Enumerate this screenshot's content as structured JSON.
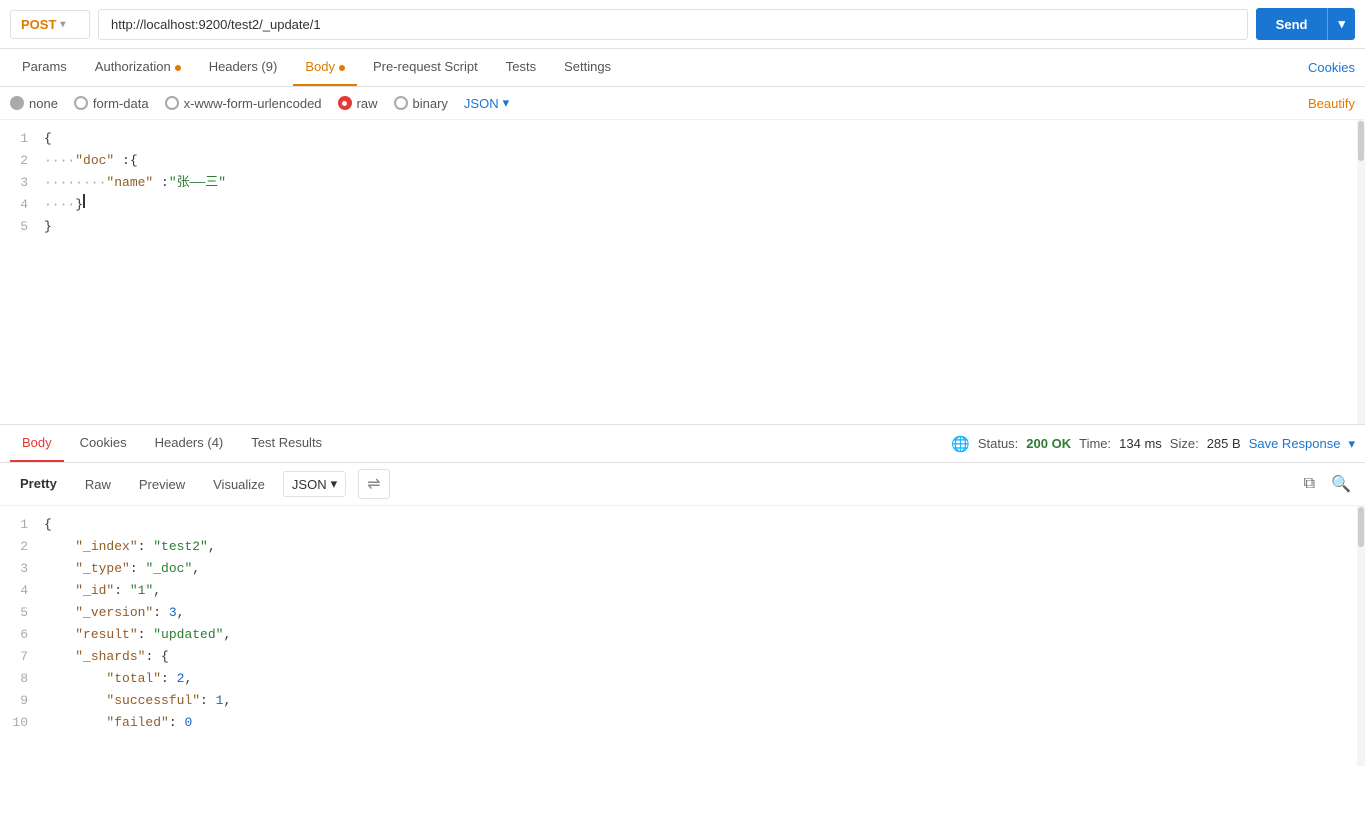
{
  "url_bar": {
    "method": "POST",
    "url": "http://localhost:9200/test2/_update/1",
    "send_label": "Send"
  },
  "request_tabs": {
    "items": [
      {
        "label": "Params",
        "active": false,
        "dot": null
      },
      {
        "label": "Authorization",
        "active": false,
        "dot": "orange"
      },
      {
        "label": "Headers (9)",
        "active": false,
        "dot": null
      },
      {
        "label": "Body",
        "active": true,
        "dot": "orange"
      },
      {
        "label": "Pre-request Script",
        "active": false,
        "dot": null
      },
      {
        "label": "Tests",
        "active": false,
        "dot": null
      },
      {
        "label": "Settings",
        "active": false,
        "dot": null
      }
    ],
    "cookies_link": "Cookies"
  },
  "body_options": {
    "none_label": "none",
    "form_data_label": "form-data",
    "urlencoded_label": "x-www-form-urlencoded",
    "raw_label": "raw",
    "binary_label": "binary",
    "json_label": "JSON",
    "beautify_label": "Beautify"
  },
  "request_body_lines": [
    {
      "num": 1,
      "content": "{"
    },
    {
      "num": 2,
      "content": "    \"doc\" :{"
    },
    {
      "num": 3,
      "content": "        \"name\" :\"张——三\""
    },
    {
      "num": 4,
      "content": "    }"
    },
    {
      "num": 5,
      "content": "}"
    }
  ],
  "response_tabs": {
    "items": [
      {
        "label": "Body",
        "active": true
      },
      {
        "label": "Cookies",
        "active": false
      },
      {
        "label": "Headers (4)",
        "active": false
      },
      {
        "label": "Test Results",
        "active": false
      }
    ],
    "status_label": "Status:",
    "status_code": "200",
    "status_text": "OK",
    "time_label": "Time:",
    "time_value": "134 ms",
    "size_label": "Size:",
    "size_value": "285 B",
    "save_response_label": "Save Response"
  },
  "response_format": {
    "pretty_label": "Pretty",
    "raw_label": "Raw",
    "preview_label": "Preview",
    "visualize_label": "Visualize",
    "json_label": "JSON"
  },
  "response_lines": [
    {
      "num": 1,
      "content": "{"
    },
    {
      "num": 2,
      "content": "    \"_index\": \"test2\","
    },
    {
      "num": 3,
      "content": "    \"_type\": \"_doc\","
    },
    {
      "num": 4,
      "content": "    \"_id\": \"1\","
    },
    {
      "num": 5,
      "content": "    \"_version\": 3,"
    },
    {
      "num": 6,
      "content": "    \"result\": \"updated\","
    },
    {
      "num": 7,
      "content": "    \"_shards\": {"
    },
    {
      "num": 8,
      "content": "        \"total\": 2,"
    },
    {
      "num": 9,
      "content": "        \"successful\": 1,"
    },
    {
      "num": 10,
      "content": "        \"failed\": 0"
    }
  ]
}
